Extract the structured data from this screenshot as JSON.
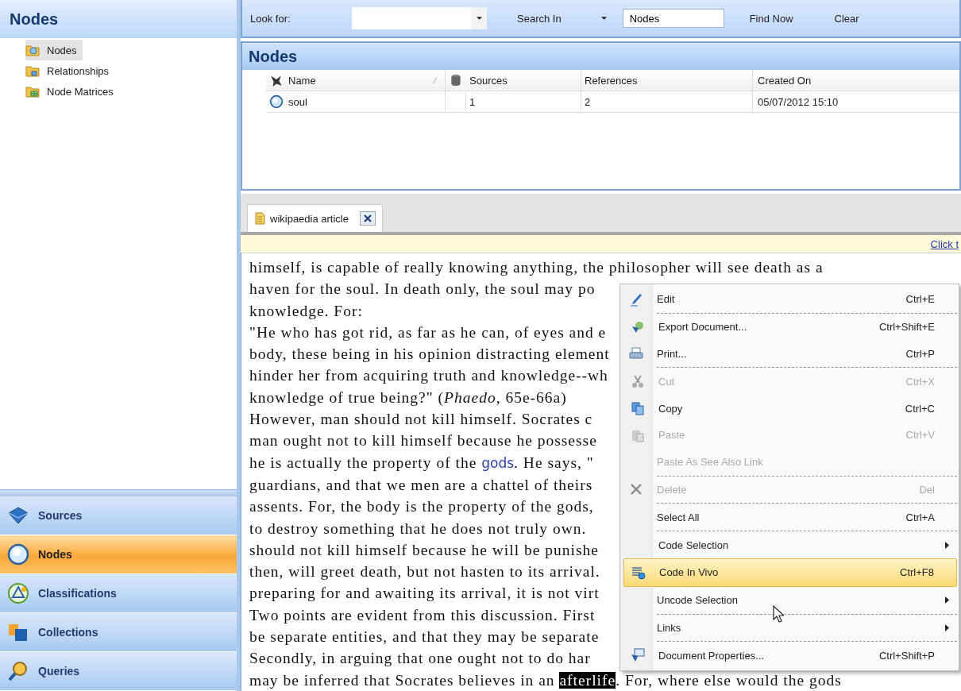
{
  "sidebar": {
    "title": "Nodes",
    "tree": [
      {
        "label": "Nodes",
        "selected": true
      },
      {
        "label": "Relationships",
        "selected": false
      },
      {
        "label": "Node Matrices",
        "selected": false
      }
    ],
    "nav": [
      {
        "label": "Sources",
        "selected": false
      },
      {
        "label": "Nodes",
        "selected": true
      },
      {
        "label": "Classifications",
        "selected": false
      },
      {
        "label": "Collections",
        "selected": false
      },
      {
        "label": "Queries",
        "selected": false
      }
    ]
  },
  "toolbar": {
    "look_for_label": "Look for:",
    "search_in": "Search In",
    "search_in_value": "Nodes",
    "find_now": "Find Now",
    "clear": "Clear"
  },
  "list": {
    "title": "Nodes",
    "columns": [
      "Name",
      "Sources",
      "References",
      "Created On"
    ],
    "rows": [
      {
        "name": "soul",
        "sources": "1",
        "references": "2",
        "created_on": "05/07/2012 15:10"
      }
    ]
  },
  "tab": {
    "label": "wikipaedia article"
  },
  "info_bar": {
    "link": "Click t"
  },
  "document": {
    "lines": [
      [
        {
          "text": "himself, is capable of really knowing anything, the philosopher will see death as a",
          "kind": "plain"
        }
      ],
      [
        {
          "text": "haven for the soul. In death only, the soul may po",
          "kind": "plain"
        }
      ],
      [
        {
          "text": "knowledge. For:",
          "kind": "plain"
        }
      ],
      [
        {
          "text": "\"He who has got rid, as far as he can, of eyes and e",
          "kind": "plain"
        }
      ],
      [
        {
          "text": "body, these being in his opinion distracting element",
          "kind": "plain"
        }
      ],
      [
        {
          "text": "hinder her from acquiring truth and knowledge--wh",
          "kind": "plain"
        }
      ],
      [
        {
          "text": "knowledge of true being?\" (",
          "kind": "plain"
        },
        {
          "text": "Phaedo",
          "kind": "italic"
        },
        {
          "text": ", 65e-66a)",
          "kind": "plain"
        }
      ],
      [
        {
          "text": "However, man should not kill himself. Socrates c",
          "kind": "plain"
        }
      ],
      [
        {
          "text": "man ought not to kill himself because he possesse",
          "kind": "plain"
        }
      ],
      [
        {
          "text": "he is actually the property of the ",
          "kind": "plain"
        },
        {
          "text": "gods",
          "kind": "link"
        },
        {
          "text": ". He says, \"",
          "kind": "plain"
        }
      ],
      [
        {
          "text": "guardians, and that we men are a chattel of theirs",
          "kind": "plain"
        }
      ],
      [
        {
          "text": "assents. For, the body is the property of the gods,",
          "kind": "plain"
        }
      ],
      [
        {
          "text": "to destroy something that he does not truly own.",
          "kind": "plain"
        }
      ],
      [
        {
          "text": "should not kill himself because he will be punishe",
          "kind": "plain"
        }
      ],
      [
        {
          "text": "then, will greet death, but not hasten to its arrival.",
          "kind": "plain"
        }
      ],
      [
        {
          "text": "preparing for and awaiting its arrival, it is not virt",
          "kind": "plain"
        }
      ],
      [
        {
          "text": "Two points are evident from this discussion. First",
          "kind": "plain"
        }
      ],
      [
        {
          "text": "be separate entities, and that they may be separate",
          "kind": "plain"
        }
      ],
      [
        {
          "text": "Secondly, in arguing that one ought not to do har",
          "kind": "plain"
        }
      ],
      [
        {
          "text": "may be inferred that Socrates believes in an ",
          "kind": "plain"
        },
        {
          "text": "afterlife",
          "kind": "selected"
        },
        {
          "text": ". For, where else would the gods",
          "kind": "plain"
        }
      ]
    ]
  },
  "context_menu": {
    "items": [
      {
        "label": "Edit",
        "shortcut": "Ctrl+E",
        "disabled": false,
        "selected": false,
        "submenu": false,
        "separator_after": true
      },
      {
        "label": "Export Document...",
        "shortcut": "Ctrl+Shift+E",
        "disabled": false,
        "selected": false,
        "submenu": false,
        "separator_after": false
      },
      {
        "label": "Print...",
        "shortcut": "Ctrl+P",
        "disabled": false,
        "selected": false,
        "submenu": false,
        "separator_after": true
      },
      {
        "label": "Cut",
        "shortcut": "Ctrl+X",
        "disabled": true,
        "selected": false,
        "submenu": false,
        "separator_after": false
      },
      {
        "label": "Copy",
        "shortcut": "Ctrl+C",
        "disabled": false,
        "selected": false,
        "submenu": false,
        "separator_after": false
      },
      {
        "label": "Paste",
        "shortcut": "Ctrl+V",
        "disabled": true,
        "selected": false,
        "submenu": false,
        "separator_after": false
      },
      {
        "label": "Paste As See Also Link",
        "disabled": true,
        "selected": false,
        "submenu": false,
        "separator_after": true
      },
      {
        "label": "Delete",
        "shortcut": "Del",
        "disabled": true,
        "selected": false,
        "submenu": false,
        "separator_after": true
      },
      {
        "label": "Select All",
        "shortcut": "Ctrl+A",
        "disabled": false,
        "selected": false,
        "submenu": false,
        "separator_after": true
      },
      {
        "label": "Code Selection",
        "disabled": false,
        "selected": false,
        "submenu": true,
        "separator_after": false
      },
      {
        "label": "Code In Vivo",
        "shortcut": "Ctrl+F8",
        "disabled": false,
        "selected": true,
        "submenu": false,
        "separator_after": false
      },
      {
        "label": "Uncode Selection",
        "disabled": false,
        "selected": false,
        "submenu": true,
        "separator_after": true
      },
      {
        "label": "Links",
        "disabled": false,
        "selected": false,
        "submenu": true,
        "separator_after": true
      },
      {
        "label": "Document Properties...",
        "shortcut": "Ctrl+Shift+P",
        "disabled": false,
        "selected": false,
        "submenu": false,
        "separator_after": false
      }
    ]
  }
}
